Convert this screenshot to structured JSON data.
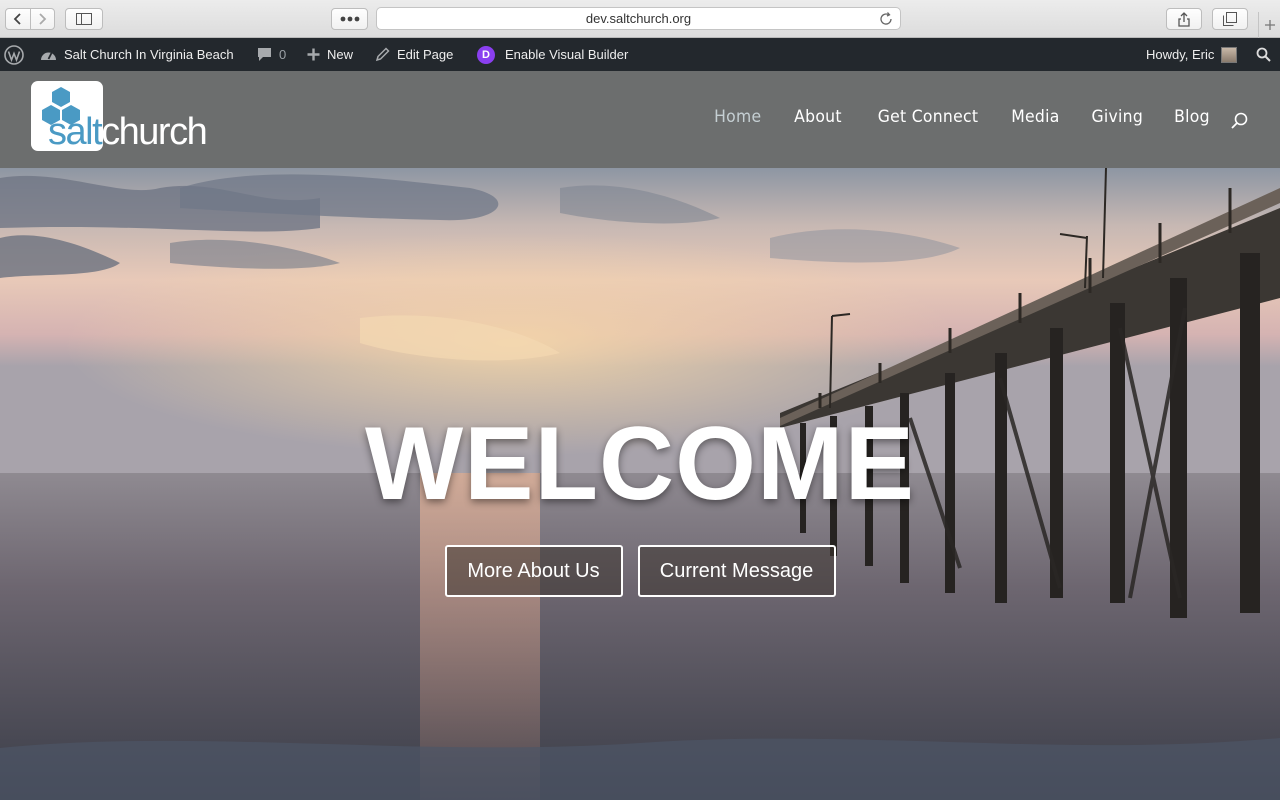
{
  "browser": {
    "url": "dev.saltchurch.org"
  },
  "admin_bar": {
    "site_name": "Salt Church In Virginia Beach",
    "comments_count": "0",
    "new_label": "New",
    "edit_page_label": "Edit Page",
    "visual_builder_label": "Enable Visual Builder",
    "howdy_label": "Howdy, Eric"
  },
  "site": {
    "logo_salt": "salt",
    "logo_church": "church",
    "nav": [
      {
        "label": "Home",
        "active": true
      },
      {
        "label": "About",
        "active": false
      },
      {
        "label": "Get Connect",
        "active": false
      },
      {
        "label": "Media",
        "active": false
      },
      {
        "label": "Giving",
        "active": false
      },
      {
        "label": "Blog",
        "active": false
      }
    ]
  },
  "hero": {
    "heading": "WELCOME",
    "buttons": [
      {
        "label": "More About Us"
      },
      {
        "label": "Current Message"
      }
    ]
  },
  "colors": {
    "admin_bar_bg": "#23282d",
    "header_bg": "#6c6e6e",
    "logo_blue": "#4a9ac4",
    "divi_purple": "#8a3ff0"
  }
}
